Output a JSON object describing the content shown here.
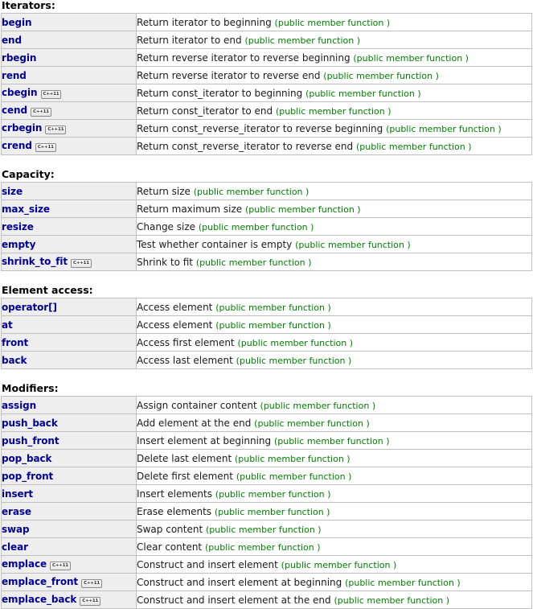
{
  "badge_label": "C++11",
  "kind_label": "(public member function )",
  "colors": {
    "link": "#000099",
    "kind_text": "#008000",
    "name_cell_bg": "#eeeeee",
    "border": "#c0c0c0"
  },
  "sections": [
    {
      "title": "Iterators:",
      "rows": [
        {
          "name": "begin",
          "badge": false,
          "desc": "Return iterator to beginning"
        },
        {
          "name": "end",
          "badge": false,
          "desc": "Return iterator to end"
        },
        {
          "name": "rbegin",
          "badge": false,
          "desc": "Return reverse iterator to reverse beginning"
        },
        {
          "name": "rend",
          "badge": false,
          "desc": "Return reverse iterator to reverse end"
        },
        {
          "name": "cbegin",
          "badge": true,
          "desc": "Return const_iterator to beginning"
        },
        {
          "name": "cend",
          "badge": true,
          "desc": "Return const_iterator to end"
        },
        {
          "name": "crbegin",
          "badge": true,
          "desc": "Return const_reverse_iterator to reverse beginning"
        },
        {
          "name": "crend",
          "badge": true,
          "desc": "Return const_reverse_iterator to reverse end"
        }
      ]
    },
    {
      "title": "Capacity:",
      "rows": [
        {
          "name": "size",
          "badge": false,
          "desc": "Return size"
        },
        {
          "name": "max_size",
          "badge": false,
          "desc": "Return maximum size"
        },
        {
          "name": "resize",
          "badge": false,
          "desc": "Change size"
        },
        {
          "name": "empty",
          "badge": false,
          "desc": "Test whether container is empty"
        },
        {
          "name": "shrink_to_fit",
          "badge": true,
          "desc": "Shrink to fit"
        }
      ]
    },
    {
      "title": "Element access:",
      "rows": [
        {
          "name": "operator[]",
          "badge": false,
          "desc": "Access element"
        },
        {
          "name": "at",
          "badge": false,
          "desc": "Access element"
        },
        {
          "name": "front",
          "badge": false,
          "desc": "Access first element"
        },
        {
          "name": "back",
          "badge": false,
          "desc": "Access last element"
        }
      ]
    },
    {
      "title": "Modifiers:",
      "rows": [
        {
          "name": "assign",
          "badge": false,
          "desc": "Assign container content"
        },
        {
          "name": "push_back",
          "badge": false,
          "desc": "Add element at the end"
        },
        {
          "name": "push_front",
          "badge": false,
          "desc": "Insert element at beginning"
        },
        {
          "name": "pop_back",
          "badge": false,
          "desc": "Delete last element"
        },
        {
          "name": "pop_front",
          "badge": false,
          "desc": "Delete first element"
        },
        {
          "name": "insert",
          "badge": false,
          "desc": "Insert elements"
        },
        {
          "name": "erase",
          "badge": false,
          "desc": "Erase elements"
        },
        {
          "name": "swap",
          "badge": false,
          "desc": "Swap content"
        },
        {
          "name": "clear",
          "badge": false,
          "desc": "Clear content"
        },
        {
          "name": "emplace",
          "badge": true,
          "desc": "Construct and insert element"
        },
        {
          "name": "emplace_front",
          "badge": true,
          "desc": "Construct and insert element at beginning"
        },
        {
          "name": "emplace_back",
          "badge": true,
          "desc": "Construct and insert element at the end"
        }
      ]
    }
  ]
}
